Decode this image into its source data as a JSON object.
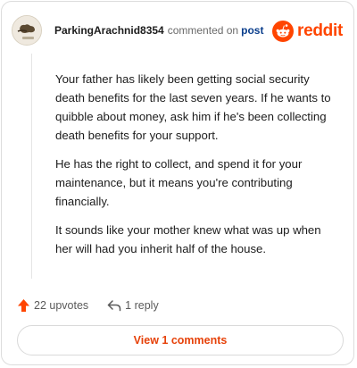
{
  "comment": {
    "username": "ParkingArachnid8354",
    "action_text": "commented on",
    "post_link": "post",
    "paragraphs": [
      "Your father has likely been getting social security death benefits for the last seven years. If he wants to quibble about money, ask him if he's been collecting death benefits for your support.",
      "He has the right to collect, and spend it for your maintenance, but it means you're contributing financially.",
      "It sounds like your mother knew what was up when her will had you inherit half of the house."
    ],
    "upvotes": "22 upvotes",
    "replies": "1 reply",
    "view_comments": "View 1 comments"
  },
  "brand": {
    "name": "reddit",
    "color": "#ff4500"
  },
  "icons": {
    "upvote": "upvote-arrow-icon",
    "reply": "reply-arrow-icon",
    "logo": "reddit-snoo-icon",
    "avatar": "user-avatar-icon"
  },
  "colors": {
    "upvote": "#ff4500",
    "link": "#0a3e8c",
    "view_button_text": "#e6420a"
  }
}
